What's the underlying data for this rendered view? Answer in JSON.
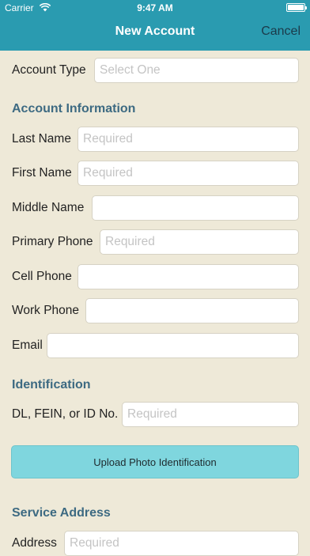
{
  "status_bar": {
    "carrier": "Carrier",
    "time": "9:47 AM"
  },
  "nav": {
    "title": "New Account",
    "cancel_label": "Cancel"
  },
  "account_type": {
    "label": "Account Type",
    "placeholder": "Select One"
  },
  "sections": {
    "account_information": "Account Information",
    "identification": "Identification",
    "service_address": "Service Address"
  },
  "fields": {
    "last_name": {
      "label": "Last Name",
      "placeholder": "Required"
    },
    "first_name": {
      "label": "First Name",
      "placeholder": "Required"
    },
    "middle_name": {
      "label": "Middle Name",
      "placeholder": ""
    },
    "primary_phone": {
      "label": "Primary Phone",
      "placeholder": "Required"
    },
    "cell_phone": {
      "label": "Cell Phone",
      "placeholder": ""
    },
    "work_phone": {
      "label": "Work Phone",
      "placeholder": ""
    },
    "email": {
      "label": "Email",
      "placeholder": ""
    },
    "id_number": {
      "label": "DL, FEIN, or ID No.",
      "placeholder": "Required"
    },
    "address": {
      "label": "Address",
      "placeholder": "Required"
    }
  },
  "upload_button_label": "Upload Photo Identification",
  "colors": {
    "header": "#2a9bb0",
    "background": "#eee9d8",
    "section_title": "#3d6a82",
    "upload_button": "#7fd6de"
  }
}
